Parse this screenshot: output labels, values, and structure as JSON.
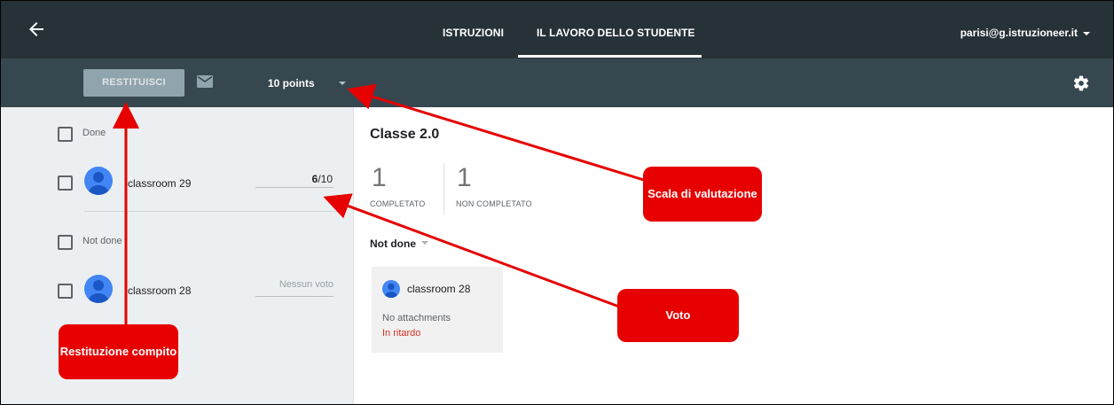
{
  "header": {
    "tabs": [
      {
        "label": "ISTRUZIONI"
      },
      {
        "label": "IL LAVORO DELLO STUDENTE"
      }
    ],
    "account": "parisi@g.istruzioneer.it"
  },
  "toolbar": {
    "return_label": "RESTITUISCI",
    "points_label": "10 points"
  },
  "left_panel": {
    "groups": [
      {
        "label": "Done",
        "students": [
          {
            "name": "classroom 29",
            "grade": "6",
            "out_of": "/10"
          }
        ]
      },
      {
        "label": "Not done",
        "students": [
          {
            "name": "classroom 28",
            "grade_placeholder": "Nessun voto"
          }
        ]
      }
    ]
  },
  "main": {
    "class_title": "Classe 2.0",
    "stats": [
      {
        "value": "1",
        "label": "COMPLETATO"
      },
      {
        "value": "1",
        "label": "NON COMPLETATO"
      }
    ],
    "filter": "Not done",
    "card": {
      "name": "classroom 28",
      "attachments": "No attachments",
      "status": "In ritardo"
    }
  },
  "annotations": {
    "grading_scale": "Scala di valutazione",
    "grade": "Voto",
    "return_assignment": "Restituzione compito"
  },
  "colors": {
    "topbar": "#263238",
    "toolbar": "#37474f",
    "callout": "#e60000",
    "late": "#d93025"
  },
  "icons": [
    "back-arrow-icon",
    "mail-icon",
    "gear-icon",
    "avatar-icon",
    "caret-down-icon"
  ]
}
